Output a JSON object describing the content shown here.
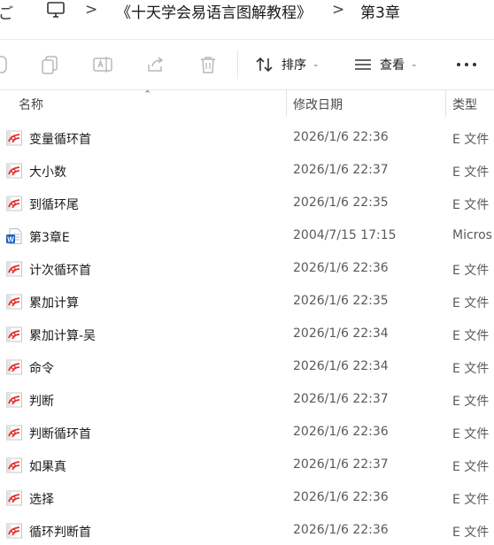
{
  "address_bar": {
    "nav_fragment": "ご",
    "pc_icon": "monitor-icon",
    "separator": ">",
    "crumbs": [
      "《十天学会易语言图解教程》",
      "第3章"
    ]
  },
  "toolbar": {
    "icons": [
      "new-icon",
      "copy-icon",
      "rename-icon",
      "share-icon",
      "delete-icon"
    ],
    "sort_label": "排序",
    "view_label": "查看",
    "more": "more-icon"
  },
  "columns": {
    "name": "名称",
    "date": "修改日期",
    "type": "类型"
  },
  "files": [
    {
      "name": "变量循环首",
      "date": "2026/1/6 22:36",
      "type": "E 文件",
      "icon": "e-file-icon"
    },
    {
      "name": "大小数",
      "date": "2026/1/6 22:37",
      "type": "E 文件",
      "icon": "e-file-icon"
    },
    {
      "name": "到循环尾",
      "date": "2026/1/6 22:35",
      "type": "E 文件",
      "icon": "e-file-icon"
    },
    {
      "name": "第3章E",
      "date": "2004/7/15 17:15",
      "type": "Micros",
      "icon": "word-doc-icon"
    },
    {
      "name": "计次循环首",
      "date": "2026/1/6 22:36",
      "type": "E 文件",
      "icon": "e-file-icon"
    },
    {
      "name": "累加计算",
      "date": "2026/1/6 22:35",
      "type": "E 文件",
      "icon": "e-file-icon"
    },
    {
      "name": "累加计算-吴",
      "date": "2026/1/6 22:34",
      "type": "E 文件",
      "icon": "e-file-icon"
    },
    {
      "name": "命令",
      "date": "2026/1/6 22:34",
      "type": "E 文件",
      "icon": "e-file-icon"
    },
    {
      "name": "判断",
      "date": "2026/1/6 22:37",
      "type": "E 文件",
      "icon": "e-file-icon"
    },
    {
      "name": "判断循环首",
      "date": "2026/1/6 22:36",
      "type": "E 文件",
      "icon": "e-file-icon"
    },
    {
      "name": "如果真",
      "date": "2026/1/6 22:37",
      "type": "E 文件",
      "icon": "e-file-icon"
    },
    {
      "name": "选择",
      "date": "2026/1/6 22:36",
      "type": "E 文件",
      "icon": "e-file-icon"
    },
    {
      "name": "循环判断首",
      "date": "2026/1/6 22:36",
      "type": "E 文件",
      "icon": "e-file-icon"
    }
  ]
}
